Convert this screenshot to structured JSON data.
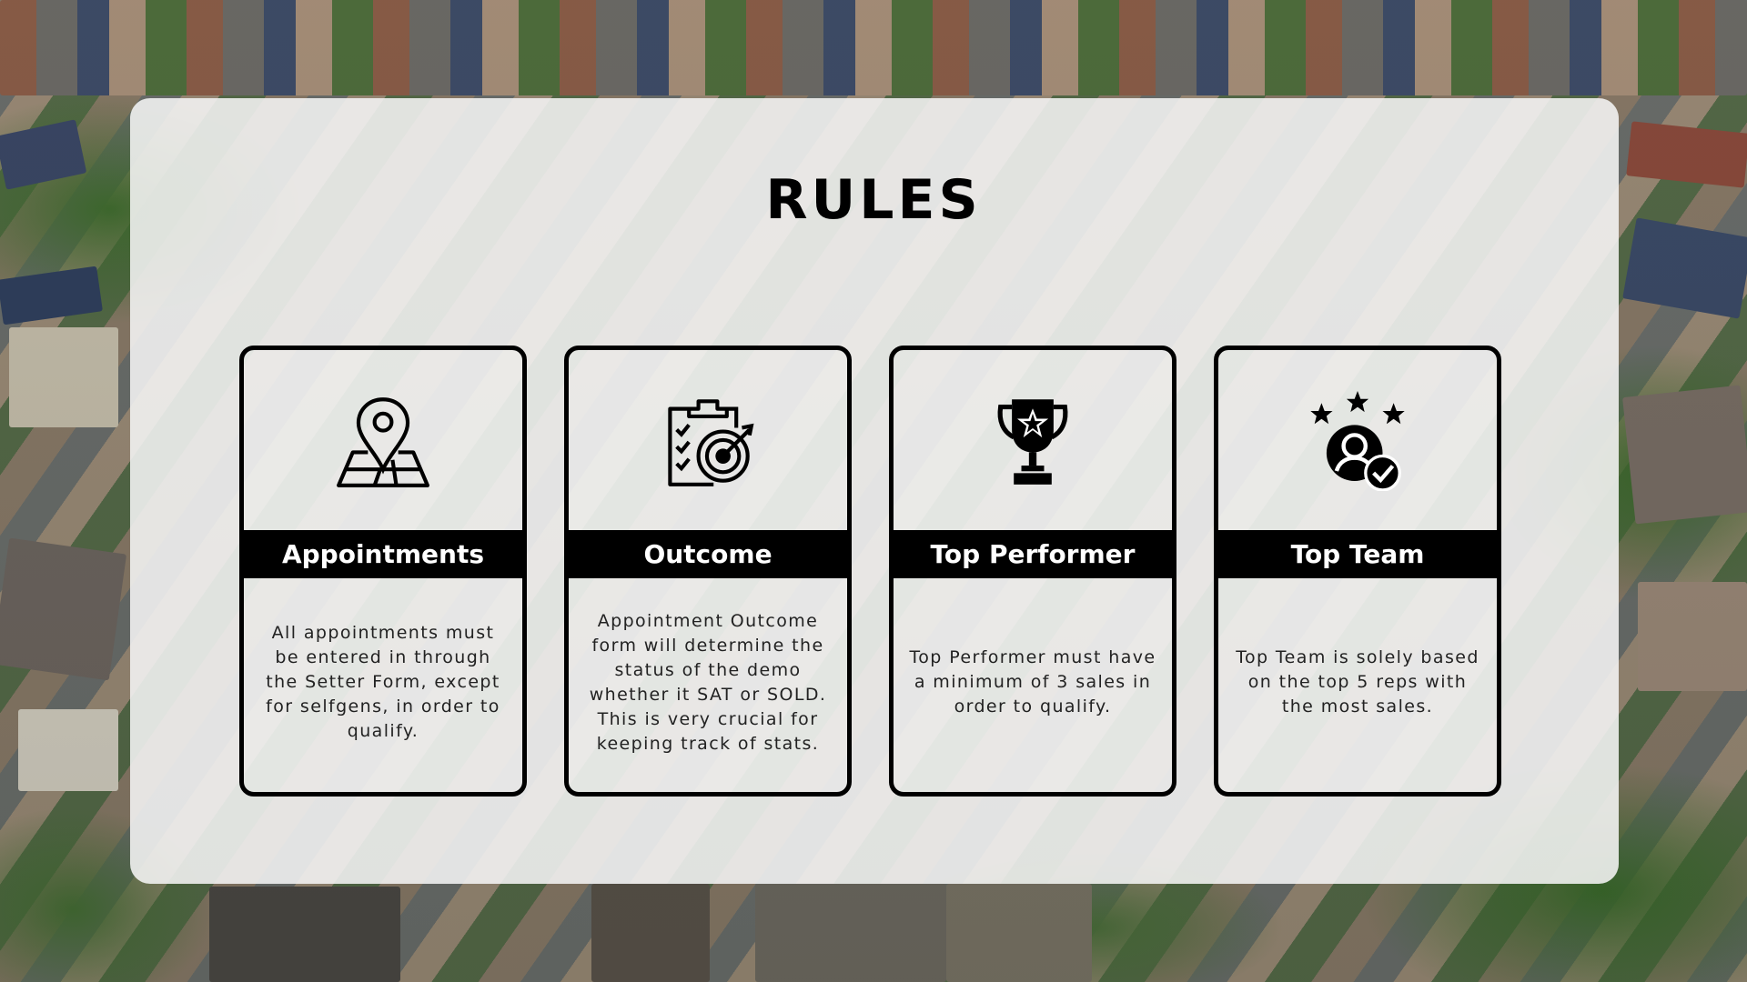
{
  "title": "RULES",
  "cards": [
    {
      "heading": "Appointments",
      "icon": "map-pin-icon",
      "text": "All appointments must be entered in through the Setter Form, except for selfgens, in order to qualify."
    },
    {
      "heading": "Outcome",
      "icon": "clipboard-target-icon",
      "text": "Appointment Outcome form will determine the status of the demo whether it SAT or SOLD. This is very crucial for keeping track of stats."
    },
    {
      "heading": "Top Performer",
      "icon": "trophy-icon",
      "text": "Top Performer must have a minimum of 3 sales in order to qualify."
    },
    {
      "heading": "Top Team",
      "icon": "team-member-check-icon",
      "text": "Top Team is solely based on the top 5 reps with the most sales."
    }
  ],
  "colors": {
    "panel": "#f5f5f5",
    "band": "#000000",
    "band_text": "#ffffff",
    "card_border": "#000000"
  }
}
